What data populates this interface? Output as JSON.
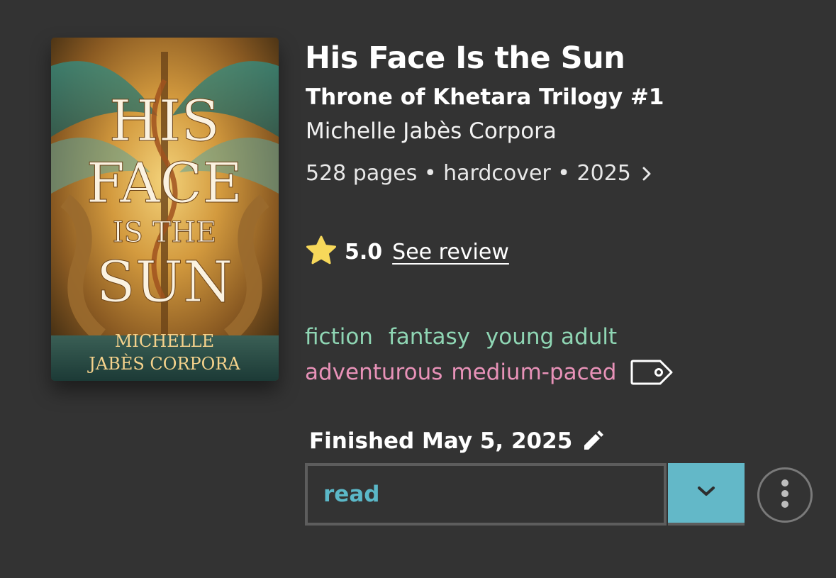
{
  "book": {
    "title": "His Face Is the Sun",
    "series": "Throne of Khetara Trilogy #1",
    "author": "Michelle Jabès Corpora",
    "meta": "528 pages • hardcover • 2025"
  },
  "cover": {
    "title_lines": [
      "HIS",
      "FACE",
      "IS THE",
      "SUN"
    ],
    "author_lines": [
      "MICHELLE",
      "JABÈS CORPORA"
    ]
  },
  "rating": {
    "score": "5.0",
    "review_link": "See review",
    "star_color": "#f7d85a"
  },
  "genres": [
    "fiction",
    "fantasy",
    "young adult"
  ],
  "moods": [
    "adventurous",
    "medium-paced"
  ],
  "colors": {
    "background": "#333333",
    "genre_tag": "#8fd6b4",
    "mood_tag": "#e892b8",
    "accent": "#63b8c8"
  },
  "status": {
    "finished_label": "Finished May 5, 2025",
    "value": "read"
  },
  "icons": {
    "meta": "chevron-right-icon",
    "rating": "star-icon",
    "tags": "tag-icon",
    "edit": "pencil-icon",
    "dropdown": "chevron-down-icon",
    "more": "more-vertical-icon"
  }
}
